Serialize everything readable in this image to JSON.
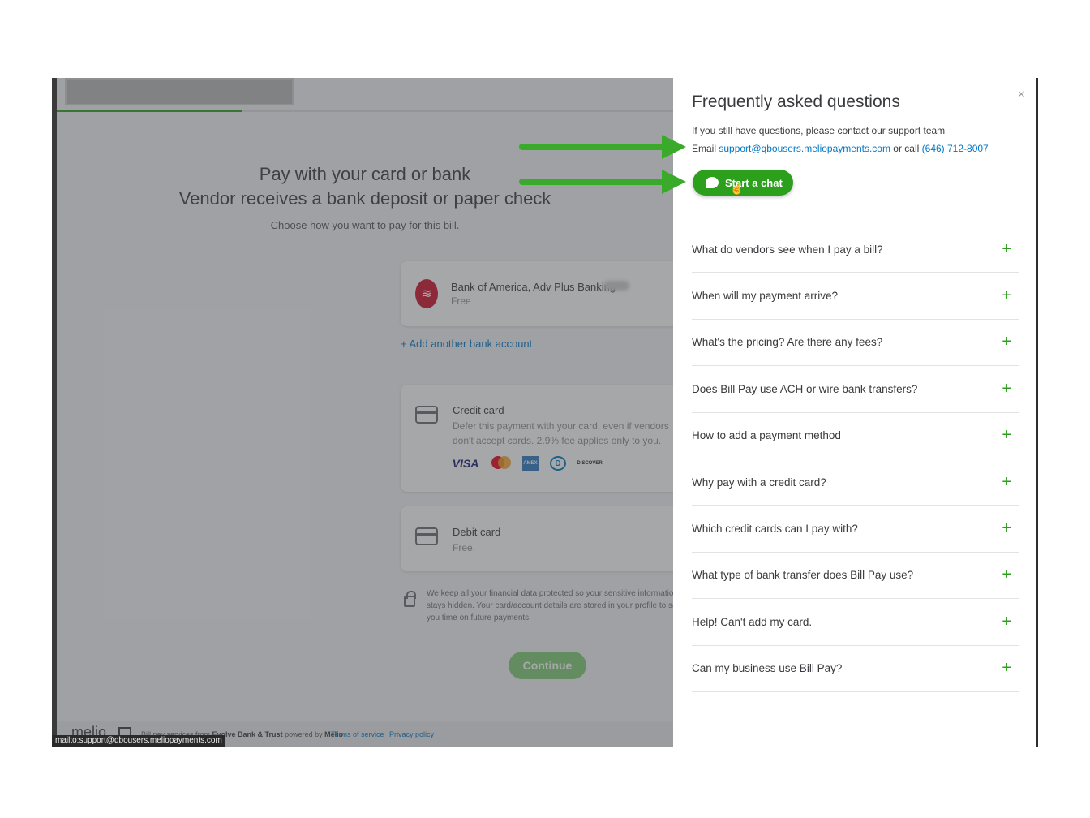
{
  "app": {
    "title_line1": "Pay with your card or bank",
    "title_line2": "Vendor receives a bank deposit or paper check",
    "subtitle": "Choose how you want to pay for this bill.",
    "progress": 0.3,
    "bank": {
      "name": "Bank of America, Adv Plus Banking",
      "fee": "Free"
    },
    "add_bank_label": "+ Add another bank account",
    "credit": {
      "title": "Credit card",
      "description": "Defer this payment with your card, even if vendors don't accept cards. 2.9% fee applies only to you.",
      "brands": [
        "VISA",
        "AMEX",
        "D",
        "DISCOVER"
      ]
    },
    "debit": {
      "title": "Debit card",
      "fee": "Free."
    },
    "secure_note": "We keep all your financial data protected so your sensitive information stays hidden. Your card/account details are stored in your profile to save you time on future payments.",
    "continue_label": "Continue",
    "footer": {
      "logo": "melio",
      "text_pre": "Bill pay services from ",
      "text_bank": "Evolve Bank & Trust",
      "text_mid": " powered by ",
      "text_brand": "Melio",
      "terms": "Terms of service",
      "privacy": "Privacy policy"
    },
    "status_url": "mailto:support@qbousers.meliopayments.com"
  },
  "faq": {
    "close": "×",
    "title": "Frequently asked questions",
    "subtitle": "If you still have questions, please contact our support team",
    "email_prefix": "Email ",
    "email": "support@qbousers.meliopayments.com",
    "or_call": " or call ",
    "phone": "(646) 712-8007",
    "chat_label": "Start a chat",
    "questions": [
      "What do vendors see when I pay a bill?",
      "When will my payment arrive?",
      "What's the pricing? Are there any fees?",
      "Does Bill Pay use ACH or wire bank transfers?",
      "How to add a payment method",
      "Why pay with a credit card?",
      "Which credit cards can I pay with?",
      "What type of bank transfer does Bill Pay use?",
      "Help! Can't add my card.",
      "Can my business use Bill Pay?"
    ],
    "plus": "+"
  },
  "colors": {
    "accent_green": "#2ca01c",
    "link_blue": "#0077c5",
    "annotation_green": "#3aaa2a"
  }
}
